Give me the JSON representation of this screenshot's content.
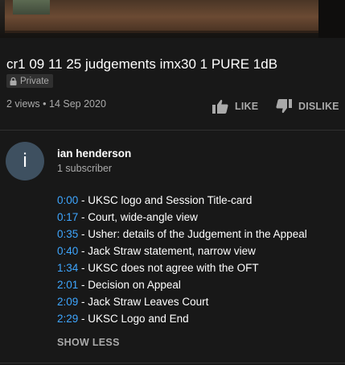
{
  "video": {
    "title": "cr1 09 11 25 judgements imx30 1 PURE 1dB",
    "privacy": "Private",
    "meta": "2 views • 14 Sep 2020"
  },
  "actions": {
    "like_label": "LIKE",
    "dislike_label": "DISLIKE"
  },
  "channel": {
    "avatar_letter": "i",
    "name": "ian henderson",
    "subscribers": "1 subscriber",
    "avatar_color": "#3e5060"
  },
  "description": {
    "chapters": [
      {
        "time": "0:00",
        "text": " - UKSC logo and Session Title-card"
      },
      {
        "time": "0:17",
        "text": " - Court, wide-angle view"
      },
      {
        "time": "0:35",
        "text": " - Usher: details of the Judgement in the Appeal"
      },
      {
        "time": "0:40",
        "text": " - Jack Straw statement, narrow view"
      },
      {
        "time": "1:34",
        "text": " - UKSC does not agree with the OFT"
      },
      {
        "time": "2:01",
        "text": " - Decision on Appeal"
      },
      {
        "time": "2:09",
        "text": " - Jack Straw Leaves Court"
      },
      {
        "time": "2:29",
        "text": " - UKSC Logo and End"
      }
    ],
    "show_less_label": "SHOW LESS"
  },
  "colors": {
    "background": "#181818",
    "link": "#3ea6ff",
    "secondary_text": "#aaaaaa"
  },
  "icons": {
    "lock": "lock-icon",
    "like": "thumb-up-icon",
    "dislike": "thumb-down-icon"
  }
}
